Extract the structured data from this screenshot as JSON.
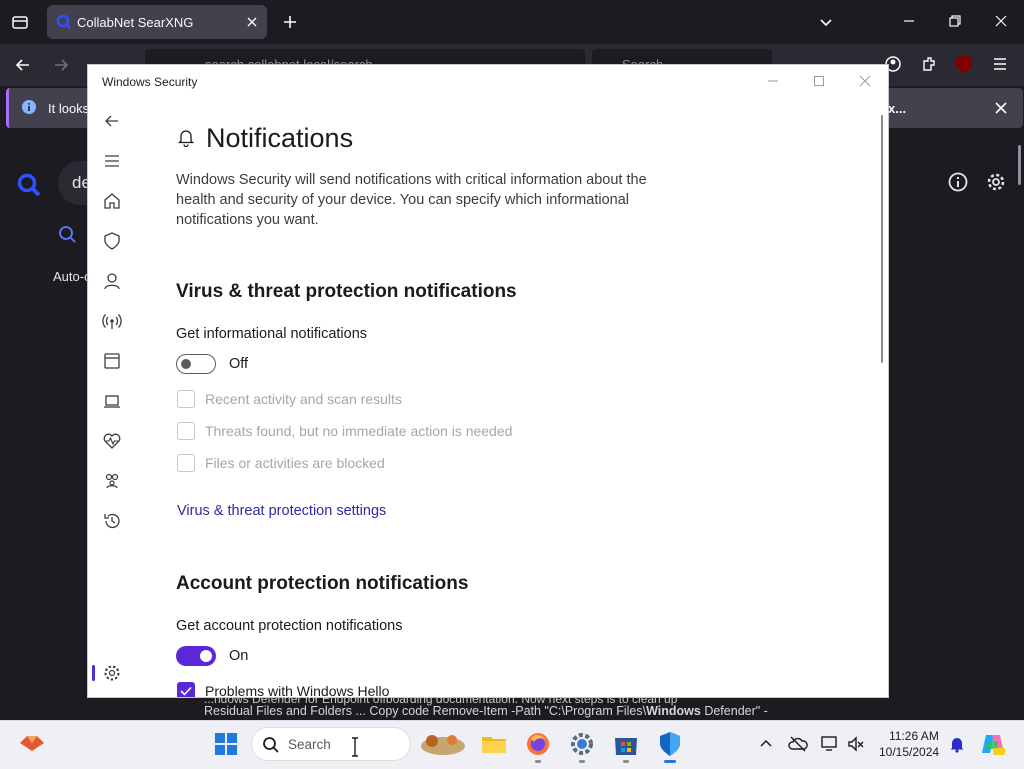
{
  "browser": {
    "tab_title": "CollabNet SearXNG",
    "url_text": "search.collabnet.local/search",
    "search_placeholder": "Search",
    "infobar_text": "It looks l",
    "infobar_tail": "x...",
    "colors": {
      "tab_active": "#42414d",
      "accent": "#a66fff"
    }
  },
  "searx_page": {
    "query_text": "de",
    "autocomplete_label": "Auto-c"
  },
  "result_snippet": {
    "line1": "...ndows Defender for Endpoint offboarding documentation. Now next steps is to clean up",
    "line2_prefix": "Residual Files and Folders ... Copy code Remove-Item -Path \"C:\\Program Files\\",
    "line2_bold": "Windows",
    "line2_suffix": " Defender\" -"
  },
  "window": {
    "title": "Windows Security",
    "accent": "#5b28d9",
    "nav_icons": [
      "back-icon",
      "menu-icon",
      "home-icon",
      "shield-icon",
      "account-icon",
      "firewall-icon",
      "app-browser-icon",
      "device-security-icon",
      "health-icon",
      "family-icon",
      "history-icon",
      "settings-icon"
    ]
  },
  "page": {
    "title": "Notifications",
    "description": "Windows Security will send notifications with critical information about the health and security of your device. You can specify which informational notifications you want.",
    "virus": {
      "heading": "Virus & threat protection notifications",
      "toggle_label": "Get informational notifications",
      "toggle_state": "Off",
      "checkboxes": [
        {
          "label": "Recent activity and scan results",
          "checked": false
        },
        {
          "label": "Threats found, but no immediate action is needed",
          "checked": false
        },
        {
          "label": "Files or activities are blocked",
          "checked": false
        }
      ],
      "link": "Virus & threat protection settings"
    },
    "account": {
      "heading": "Account protection notifications",
      "toggle_label": "Get account protection notifications",
      "toggle_state": "On",
      "checkboxes": [
        {
          "label": "Problems with Windows Hello",
          "checked": true
        }
      ]
    }
  },
  "taskbar": {
    "search_placeholder": "Search",
    "time": "11:26 AM",
    "date": "10/15/2024",
    "pinned": [
      "start-icon",
      "file-explorer-icon",
      "firefox-icon",
      "settings-app-icon",
      "store-icon",
      "windows-security-icon"
    ]
  }
}
